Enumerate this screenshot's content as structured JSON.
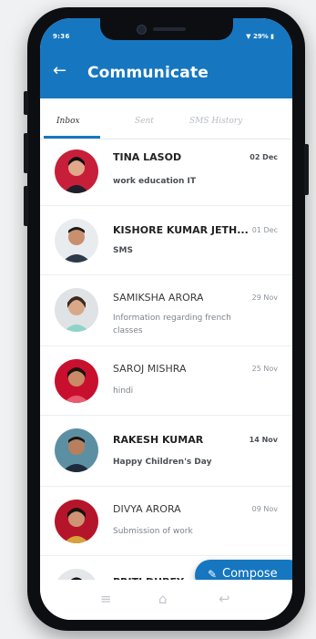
{
  "status_bar": {
    "time": "9:36",
    "right_status": "▼ 29% ▮"
  },
  "appbar": {
    "back_icon": "arrow-left-icon",
    "title": "Communicate"
  },
  "tabs": [
    {
      "label": "Inbox",
      "active": true
    },
    {
      "label": "Sent",
      "active": false
    },
    {
      "label": "SMS History",
      "active": false
    }
  ],
  "messages": [
    {
      "name": "TINA  LASOD",
      "date": "02 Dec",
      "snippet": "work education IT",
      "unread": true
    },
    {
      "name": "KISHORE KUMAR JETH...",
      "date": "01 Dec",
      "snippet": "SMS",
      "unread": true
    },
    {
      "name": "SAMIKSHA ARORA",
      "date": "29 Nov",
      "snippet": "Information regarding french classes",
      "unread": false
    },
    {
      "name": "SAROJ MISHRA",
      "date": "25 Nov",
      "snippet": "hindi",
      "unread": false
    },
    {
      "name": "RAKESH KUMAR",
      "date": "14 Nov",
      "snippet": "Happy Children's Day",
      "unread": true
    },
    {
      "name": "DIVYA ARORA",
      "date": "09 Nov",
      "snippet": "Submission of work",
      "unread": false
    },
    {
      "name": "PRITI DUBEY",
      "date": "",
      "snippet": "",
      "unread": true
    }
  ],
  "compose_button": {
    "icon": "pencil-icon",
    "label": "Compose"
  },
  "nav_bar": {
    "icons": [
      "menu-icon",
      "home-icon",
      "back-icon"
    ]
  },
  "colors": {
    "primary": "#1677c0",
    "phone_frame": "#0c0e12"
  }
}
